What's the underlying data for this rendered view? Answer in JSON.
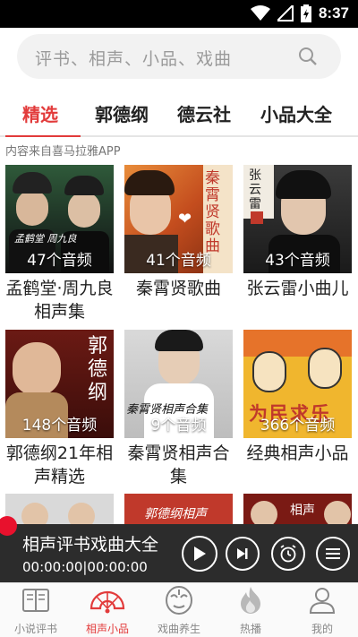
{
  "status_bar": {
    "time": "8:37"
  },
  "search": {
    "placeholder": "评书、相声、小品、戏曲"
  },
  "tabs": [
    {
      "label": "精选",
      "active": true
    },
    {
      "label": "郭德纲",
      "active": false
    },
    {
      "label": "德云社",
      "active": false
    },
    {
      "label": "小品大全",
      "active": false
    }
  ],
  "source_note": "内容来自喜马拉雅APP",
  "albums": [
    {
      "title": "孟鹤堂·周九良 相声集",
      "count": "47个音频",
      "cover_text": "孟鹤堂 周九良"
    },
    {
      "title": "秦霄贤歌曲",
      "count": "41个音频",
      "cover_text": "秦霄贤歌曲"
    },
    {
      "title": "张云雷小曲儿",
      "count": "43个音频",
      "cover_text": "张云雷"
    },
    {
      "title": "郭德纲21年相声精选",
      "count": "148个音频",
      "cover_text": "郭德纲"
    },
    {
      "title": "秦霄贤相声合集",
      "count": "9个音频",
      "cover_text": "秦霄贤相声合集"
    },
    {
      "title": "经典相声小品",
      "count": "366个音频",
      "cover_text": "为民求乐"
    }
  ],
  "partial_covers": {
    "second": "郭德纲相声",
    "third": "相声"
  },
  "player": {
    "title": "相声评书戏曲大全",
    "time": "00:00:00|00:00:00"
  },
  "bottom_nav": [
    {
      "label": "小说评书",
      "icon": "book-icon",
      "active": false
    },
    {
      "label": "相声小品",
      "icon": "fan-icon",
      "active": true
    },
    {
      "label": "戏曲养生",
      "icon": "opera-mask-icon",
      "active": false
    },
    {
      "label": "热播",
      "icon": "flame-icon",
      "active": false
    },
    {
      "label": "我的",
      "icon": "person-icon",
      "active": false
    }
  ],
  "colors": {
    "accent": "#e23b3b",
    "player_bg": "#2c2c2c",
    "record_dot": "#e8112d"
  }
}
